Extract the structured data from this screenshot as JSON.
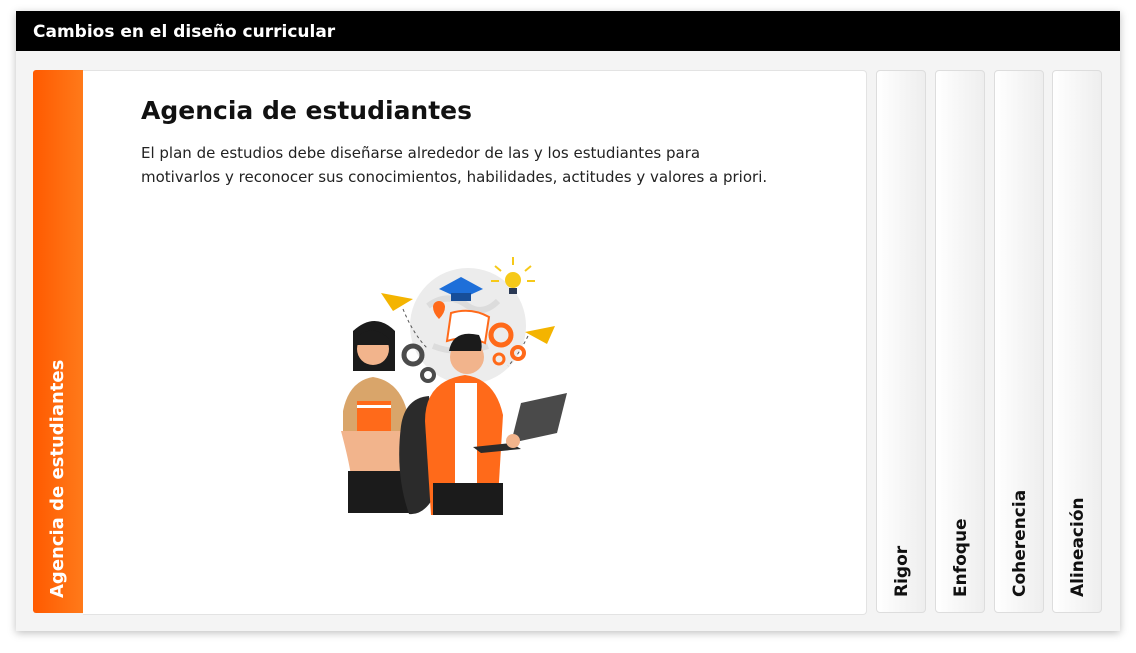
{
  "header": {
    "title": "Cambios en el diseño curricular"
  },
  "accordion": {
    "active": {
      "tab_label": "Agencia de estudiantes",
      "heading": "Agencia de estudiantes",
      "description": "El plan de estudios debe diseñarse alrededor de las y los estudiantes para motivarlos y reconocer sus conocimientos, habilidades, actitudes y valores a priori.",
      "illustration": "students-learning-illustration"
    },
    "tabs": [
      {
        "label": "Rigor"
      },
      {
        "label": "Enfoque"
      },
      {
        "label": "Coherencia"
      },
      {
        "label": "Alineación"
      }
    ]
  },
  "colors": {
    "accent": "#ff5a00",
    "header_bg": "#000000"
  }
}
